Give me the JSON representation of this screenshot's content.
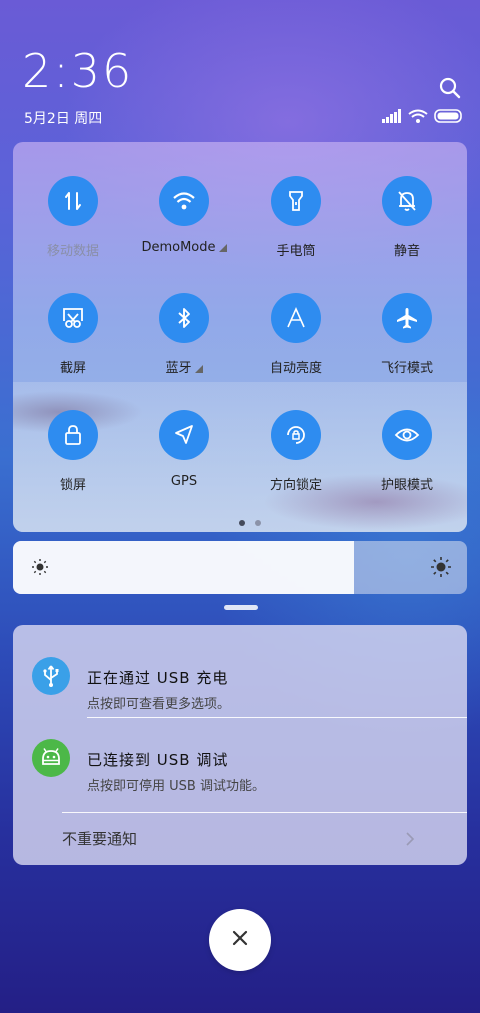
{
  "header": {
    "time": "2:36",
    "date": "5月2日 周四",
    "search_icon": "search-icon",
    "status_icons": [
      "signal-icon",
      "wifi-icon",
      "battery-icon"
    ]
  },
  "quick_settings": {
    "tiles": [
      {
        "label": "移动数据",
        "icon": "mobile-data-icon",
        "enabled": false
      },
      {
        "label": "DemoMode",
        "icon": "wifi-icon",
        "enabled": true,
        "has_more": true
      },
      {
        "label": "手电筒",
        "icon": "flashlight-icon",
        "enabled": true
      },
      {
        "label": "静音",
        "icon": "mute-bell-icon",
        "enabled": true
      },
      {
        "label": "截屏",
        "icon": "screenshot-icon",
        "enabled": true
      },
      {
        "label": "蓝牙",
        "icon": "bluetooth-icon",
        "enabled": true,
        "has_more": true
      },
      {
        "label": "自动亮度",
        "icon": "auto-brightness-icon",
        "enabled": true
      },
      {
        "label": "飞行模式",
        "icon": "airplane-icon",
        "enabled": true
      },
      {
        "label": "锁屏",
        "icon": "lock-icon",
        "enabled": true
      },
      {
        "label": "GPS",
        "icon": "location-arrow-icon",
        "enabled": true
      },
      {
        "label": "方向锁定",
        "icon": "rotation-lock-icon",
        "enabled": true
      },
      {
        "label": "护眼模式",
        "icon": "eye-icon",
        "enabled": true
      }
    ],
    "pages": {
      "count": 2,
      "current": 1
    }
  },
  "brightness": {
    "level": 0.75,
    "min_icon": "sun-small-icon",
    "max_icon": "sun-large-icon"
  },
  "notifications": [
    {
      "title": "正在通过 USB 充电",
      "text": "点按即可查看更多选项。",
      "icon": "usb-icon",
      "icon_color": "#3aa0e8"
    },
    {
      "title": "已连接到 USB 调试",
      "text": "点按即可停用 USB 调试功能。",
      "icon": "android-icon",
      "icon_color": "#4cb848"
    }
  ],
  "notifications_footer": "不重要通知",
  "colors": {
    "tile_blue": "#2e8cf0"
  },
  "close_icon": "close-icon"
}
